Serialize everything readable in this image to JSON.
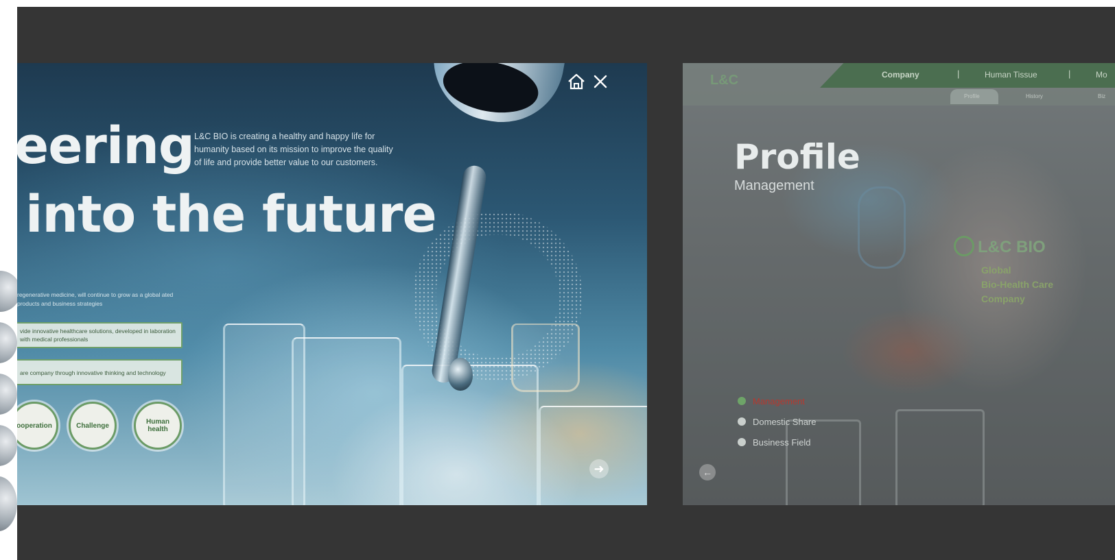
{
  "slide1": {
    "headline_line1": "eering",
    "headline_line2": "into the future",
    "intro_text": "L&C BIO is creating a healthy and happy life for humanity based on its mission to improve the quality of life and provide better value to our customers.",
    "small_text": "regenerative medicine, will continue to grow as a global ated products and business strategies",
    "pill1_text": "vide innovative healthcare solutions, developed in laboration with medical professionals",
    "pill2_text": "are company through innovative thinking and technology",
    "circles": [
      "ooperation",
      "Challenge",
      "Human health"
    ],
    "icons": {
      "home": "home-icon",
      "close": "close-icon",
      "next": "arrow-right-icon"
    }
  },
  "slide2": {
    "logo_text": "L&C",
    "nav": [
      "Company",
      "Human Tissue",
      "Mo"
    ],
    "subnav": [
      "Profile",
      "History",
      "Biz"
    ],
    "title": "Profile",
    "subtitle": "Management",
    "brand": "L&C BIO",
    "tagline": [
      "Global",
      "Bio-Health Care",
      "Company"
    ],
    "list": [
      {
        "label": "Management",
        "active": true
      },
      {
        "label": "Domestic Share",
        "active": false
      },
      {
        "label": "Business Field",
        "active": false
      }
    ],
    "icons": {
      "prev": "arrow-left-icon"
    }
  },
  "colors": {
    "stage_background": "#353535",
    "accent_green": "#6b9b66",
    "nav_green": "#4b6e50"
  }
}
